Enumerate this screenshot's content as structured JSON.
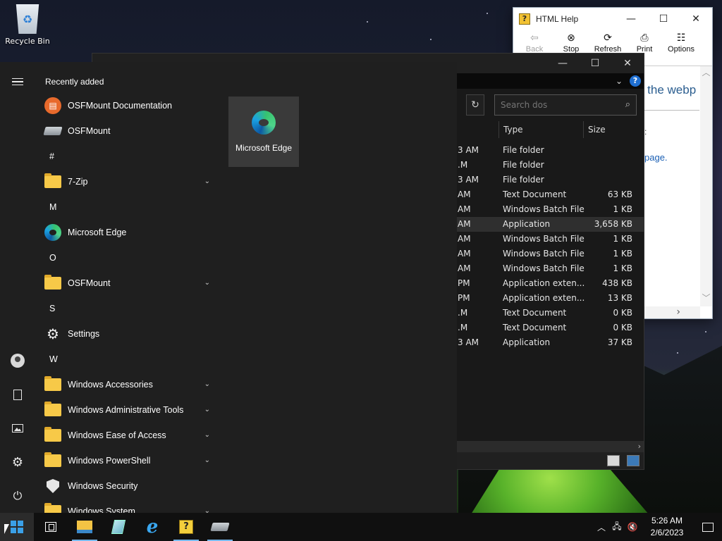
{
  "desktop": {
    "recycle_bin_label": "Recycle Bin"
  },
  "help_window": {
    "title": "HTML Help",
    "toolbar": [
      {
        "label": "Back",
        "icon": "back-arrow-icon",
        "enabled": false
      },
      {
        "label": "Stop",
        "icon": "stop-icon",
        "enabled": true
      },
      {
        "label": "Refresh",
        "icon": "refresh-icon",
        "enabled": true
      },
      {
        "label": "Print",
        "icon": "printer-icon",
        "enabled": true
      },
      {
        "label": "Options",
        "icon": "options-icon",
        "enabled": true
      }
    ],
    "content_heading": "o the webp",
    "content_text": ":",
    "content_link": "page."
  },
  "explorer": {
    "search_placeholder": "Search dos",
    "columns": {
      "type": "Type",
      "size": "Size"
    },
    "rows": [
      {
        "date": "3 AM",
        "type": "File folder",
        "size": ""
      },
      {
        "date": ".M",
        "type": "File folder",
        "size": ""
      },
      {
        "date": "3 AM",
        "type": "File folder",
        "size": ""
      },
      {
        "date": "AM",
        "type": "Text Document",
        "size": "63 KB"
      },
      {
        "date": "AM",
        "type": "Windows Batch File",
        "size": "1 KB"
      },
      {
        "date": "AM",
        "type": "Application",
        "size": "3,658 KB"
      },
      {
        "date": "AM",
        "type": "Windows Batch File",
        "size": "1 KB"
      },
      {
        "date": "AM",
        "type": "Windows Batch File",
        "size": "1 KB"
      },
      {
        "date": "AM",
        "type": "Windows Batch File",
        "size": "1 KB"
      },
      {
        "date": "PM",
        "type": "Application exten...",
        "size": "438 KB"
      },
      {
        "date": "PM",
        "type": "Application exten...",
        "size": "13 KB"
      },
      {
        "date": ".M",
        "type": "Text Document",
        "size": "0 KB"
      },
      {
        "date": ".M",
        "type": "Text Document",
        "size": "0 KB"
      },
      {
        "date": "3 AM",
        "type": "Application",
        "size": "37 KB"
      }
    ],
    "selected_row": 5
  },
  "start_menu": {
    "recently_added_label": "Recently added",
    "recent": [
      {
        "label": "OSFMount Documentation",
        "icon": "book-icon"
      },
      {
        "label": "OSFMount",
        "icon": "drive-icon"
      }
    ],
    "groups": [
      {
        "letter": "#",
        "items": [
          {
            "label": "7-Zip",
            "icon": "folder-icon",
            "expandable": true
          }
        ]
      },
      {
        "letter": "M",
        "items": [
          {
            "label": "Microsoft Edge",
            "icon": "edge-icon",
            "expandable": false
          }
        ]
      },
      {
        "letter": "O",
        "items": [
          {
            "label": "OSFMount",
            "icon": "folder-icon",
            "expandable": true
          }
        ]
      },
      {
        "letter": "S",
        "items": [
          {
            "label": "Settings",
            "icon": "gear-icon",
            "expandable": false
          }
        ]
      },
      {
        "letter": "W",
        "items": [
          {
            "label": "Windows Accessories",
            "icon": "folder-icon",
            "expandable": true
          },
          {
            "label": "Windows Administrative Tools",
            "icon": "folder-icon",
            "expandable": true
          },
          {
            "label": "Windows Ease of Access",
            "icon": "folder-icon",
            "expandable": true
          },
          {
            "label": "Windows PowerShell",
            "icon": "folder-icon",
            "expandable": true
          },
          {
            "label": "Windows Security",
            "icon": "shield-icon",
            "expandable": false
          },
          {
            "label": "Windows System",
            "icon": "folder-icon",
            "expandable": true
          }
        ]
      }
    ],
    "tile": {
      "label": "Microsoft Edge",
      "icon": "edge-icon"
    }
  },
  "taskbar": {
    "apps": [
      {
        "name": "task-view",
        "icon": "task-view-icon"
      },
      {
        "name": "file-explorer",
        "icon": "folder-icon"
      },
      {
        "name": "notepad",
        "icon": "notepad-icon"
      },
      {
        "name": "internet-explorer",
        "icon": "ie-icon"
      },
      {
        "name": "html-help",
        "icon": "help-icon"
      },
      {
        "name": "osfmount",
        "icon": "drive-icon"
      }
    ],
    "time": "5:26 AM",
    "date": "2/6/2023"
  },
  "colors": {
    "accent": "#3aa0e8",
    "start_bg": "#1f1f1f",
    "explorer_bg": "#191919",
    "link": "#1a5fb4"
  }
}
